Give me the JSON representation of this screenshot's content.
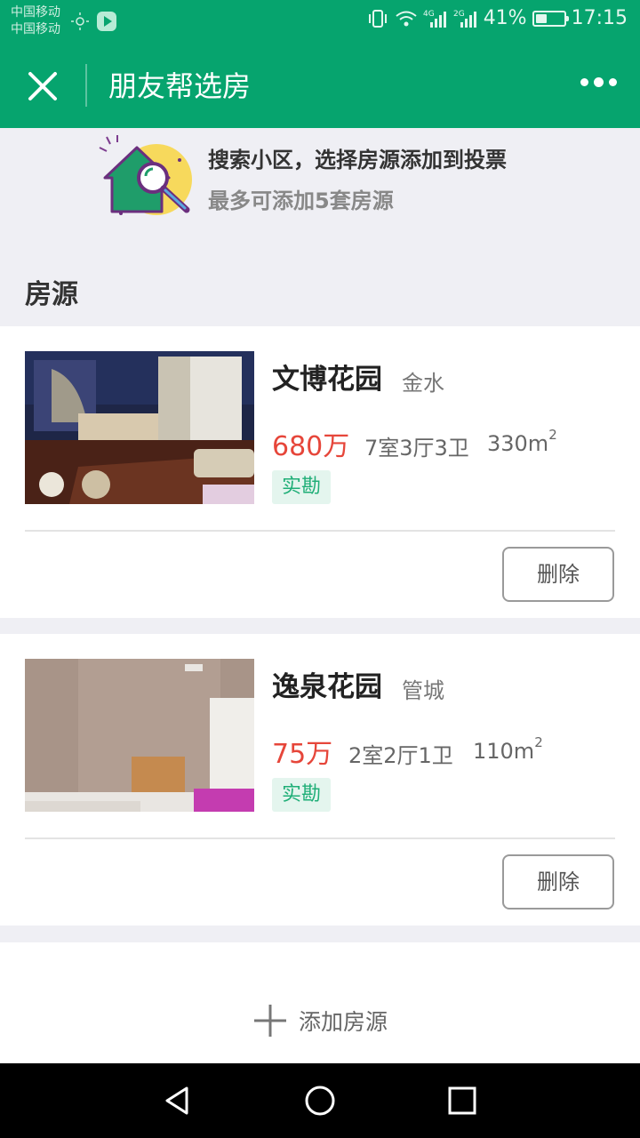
{
  "status_bar": {
    "carrier_1": "中国移动",
    "carrier_2": "中国移动",
    "network_4g": "4G",
    "network_2g": "2G",
    "battery_text": "41%",
    "battery_level": 0.41,
    "time": "17:15"
  },
  "navbar": {
    "title": "朋友帮选房",
    "close_icon": "close-icon",
    "more_icon": "more-icon"
  },
  "tip": {
    "title": "搜索小区，选择房源添加到投票",
    "subtitle": "最多可添加5套房源"
  },
  "section": {
    "title": "房源"
  },
  "listings": [
    {
      "name": "文博花园",
      "district": "金水",
      "price": "680万",
      "rooms": "7室3厅3卫",
      "area": "330m",
      "area_unit_sup": "2",
      "tag": "实勘",
      "delete_label": "删除"
    },
    {
      "name": "逸泉花园",
      "district": "管城",
      "price": "75万",
      "rooms": "2室2厅1卫",
      "area": "110m",
      "area_unit_sup": "2",
      "tag": "实勘",
      "delete_label": "删除"
    }
  ],
  "add": {
    "label": "添加房源"
  },
  "colors": {
    "brand_green": "#06a46e",
    "price_red": "#e6463a",
    "tag_green": "#1fae77"
  }
}
